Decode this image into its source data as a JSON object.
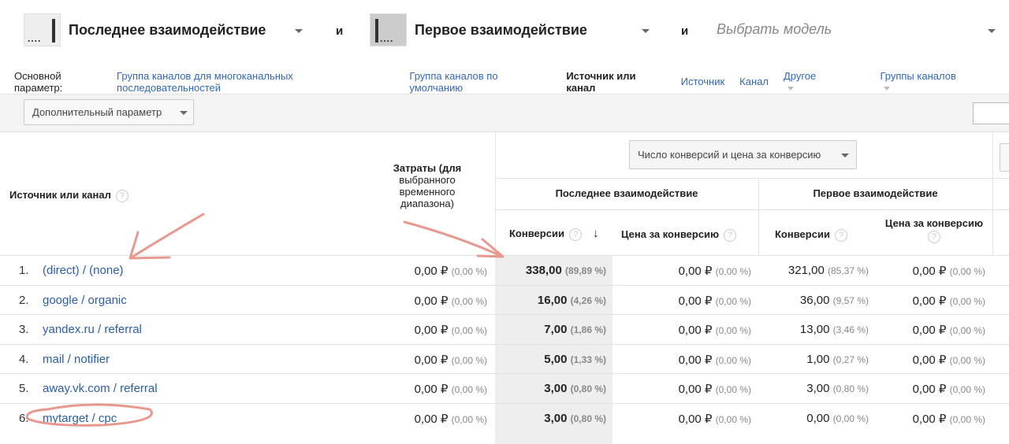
{
  "models": {
    "first": {
      "label": "Последнее взаимодействие"
    },
    "and1": "и",
    "second": {
      "label": "Первое взаимодействие"
    },
    "and2": "и",
    "third": {
      "placeholder": "Выбрать модель"
    }
  },
  "dimensions": {
    "label": "Основной параметр:",
    "items": [
      "Группа каналов для многоканальных последовательностей",
      "Группа каналов по умолчанию",
      "Источник или канал",
      "Источник",
      "Канал",
      "Другое",
      "Группы каналов"
    ]
  },
  "toolbar": {
    "secondary_dimension": "Дополнительный параметр"
  },
  "table": {
    "metric_select": "Число конверсий и цена за конверсию",
    "col_name": "Источник или канал",
    "col_cost": "Затраты (для выбранного временного диапазона)",
    "group_last": "Последнее взаимодействие",
    "group_first": "Первое взаимодействие",
    "sub_conv": "Конверсии",
    "sub_price": "Цена за конверсию",
    "rows": [
      {
        "n": "1.",
        "name": "(direct) / (none)",
        "cost": "0,00 ₽",
        "cost_pct": "(0,00 %)",
        "lc": "338,00",
        "lc_pct": "(89,89 %)",
        "lp": "0,00 ₽",
        "lp_pct": "(0,00 %)",
        "fc": "321,00",
        "fc_pct": "(85,37 %)",
        "fp": "0,00 ₽",
        "fp_pct": "(0,00 %)"
      },
      {
        "n": "2.",
        "name": "google / organic",
        "cost": "0,00 ₽",
        "cost_pct": "(0,00 %)",
        "lc": "16,00",
        "lc_pct": "(4,26 %)",
        "lp": "0,00 ₽",
        "lp_pct": "(0,00 %)",
        "fc": "36,00",
        "fc_pct": "(9,57 %)",
        "fp": "0,00 ₽",
        "fp_pct": "(0,00 %)"
      },
      {
        "n": "3.",
        "name": "yandex.ru / referral",
        "cost": "0,00 ₽",
        "cost_pct": "(0,00 %)",
        "lc": "7,00",
        "lc_pct": "(1,86 %)",
        "lp": "0,00 ₽",
        "lp_pct": "(0,00 %)",
        "fc": "13,00",
        "fc_pct": "(3,46 %)",
        "fp": "0,00 ₽",
        "fp_pct": "(0,00 %)"
      },
      {
        "n": "4.",
        "name": "mail / notifier",
        "cost": "0,00 ₽",
        "cost_pct": "(0,00 %)",
        "lc": "5,00",
        "lc_pct": "(1,33 %)",
        "lp": "0,00 ₽",
        "lp_pct": "(0,00 %)",
        "fc": "1,00",
        "fc_pct": "(0,27 %)",
        "fp": "0,00 ₽",
        "fp_pct": "(0,00 %)"
      },
      {
        "n": "5.",
        "name": "away.vk.com / referral",
        "cost": "0,00 ₽",
        "cost_pct": "(0,00 %)",
        "lc": "3,00",
        "lc_pct": "(0,80 %)",
        "lp": "0,00 ₽",
        "lp_pct": "(0,00 %)",
        "fc": "3,00",
        "fc_pct": "(0,80 %)",
        "fp": "0,00 ₽",
        "fp_pct": "(0,00 %)"
      },
      {
        "n": "6.",
        "name": "mytarget / cpc",
        "cost": "0,00 ₽",
        "cost_pct": "(0,00 %)",
        "lc": "3,00",
        "lc_pct": "(0,80 %)",
        "lp": "0,00 ₽",
        "lp_pct": "(0,00 %)",
        "fc": "0,00",
        "fc_pct": "(0,00 %)",
        "fp": "0,00 ₽",
        "fp_pct": "(0,00 %)"
      }
    ]
  },
  "colors": {
    "link": "#3468b0",
    "annotation": "#e8998f",
    "highlight": "#eeeeee"
  }
}
